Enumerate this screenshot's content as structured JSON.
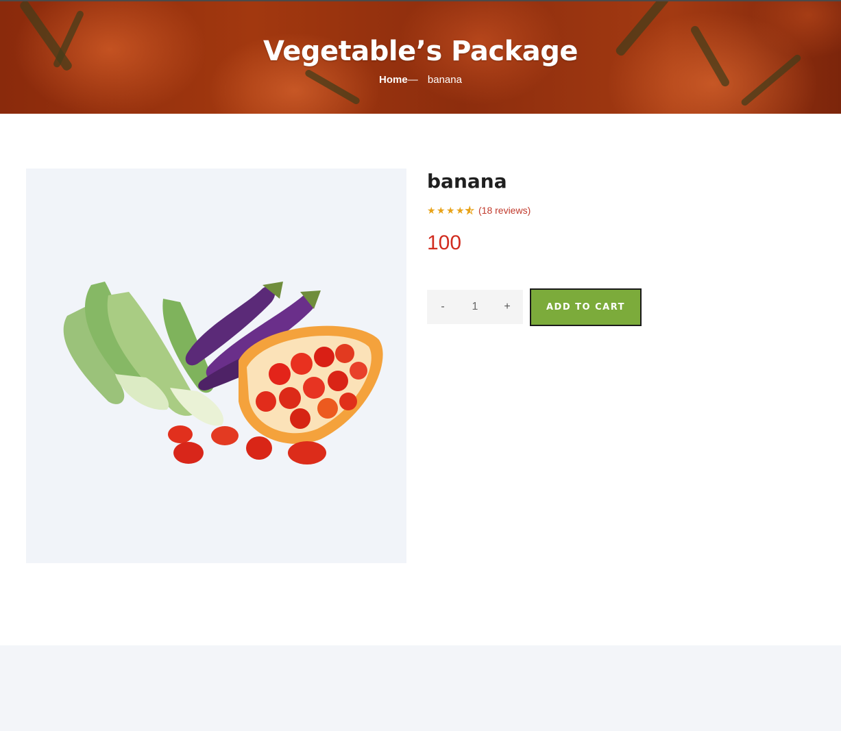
{
  "hero": {
    "title": "Vegetable’s Package",
    "breadcrumb": {
      "home": "Home",
      "separator": "—",
      "current": "banana"
    }
  },
  "product": {
    "image_alt": "Bok choy, eggplants and cherry tomatoes",
    "title": "banana",
    "rating": {
      "stars": 4.5,
      "max": 5,
      "reviews_text": "(18 reviews)"
    },
    "price": "100",
    "quantity": {
      "decrement": "-",
      "value": "1",
      "increment": "+"
    },
    "add_to_cart_label": "ADD TO CART"
  },
  "colors": {
    "accent_green": "#7cab3b",
    "price_red": "#d12c1f",
    "star_gold": "#e8a319",
    "hero_orange": "#a2380f"
  }
}
